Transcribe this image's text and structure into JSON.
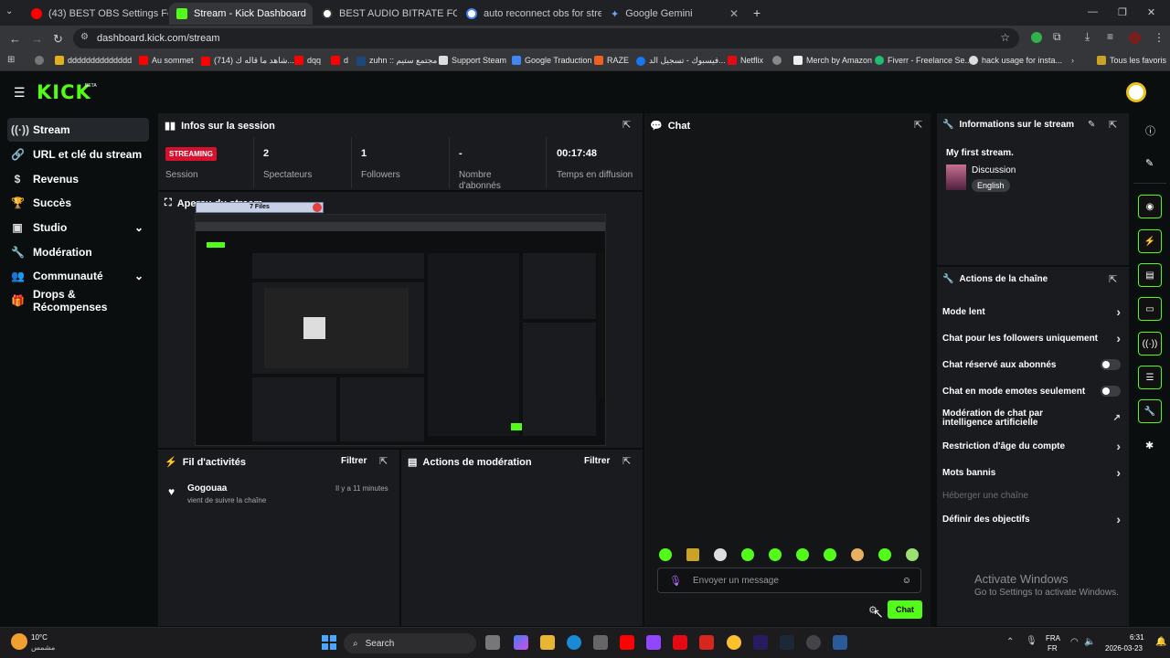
{
  "browser": {
    "tabs": [
      {
        "label": "(43) BEST OBS Settings For STR",
        "color": "#ff0000"
      },
      {
        "label": "Stream - Kick Dashboard",
        "color": "#53fc18"
      },
      {
        "label": "BEST AUDIO BITRATE FOR 505",
        "color": "#ffffff"
      },
      {
        "label": "auto reconnect obs for stream",
        "color": "#ffffff"
      },
      {
        "label": "Google Gemini",
        "color": "#6ea8ff"
      }
    ],
    "new_tab": "+",
    "url": "dashboard.kick.com/stream",
    "bookmarks": [
      "dddddddddddddd",
      "Au sommet",
      "(714) شاهد ما قاله ك...",
      "dqq",
      "d",
      "zuhn :: مجتمع ستيم",
      "Support Steam",
      "Google Traduction",
      "RAZE",
      "فيسبوك - تسجيل الد...",
      "Netflix",
      "Merch by Amazon",
      "Fiverr - Freelance Se...",
      "hack usage for insta..."
    ],
    "all_bookmarks": "Tous les favoris"
  },
  "app": {
    "logo": "KICK",
    "beta": "BETA",
    "nav": [
      {
        "label": "Stream",
        "icon": "broadcast-icon"
      },
      {
        "label": "URL et clé du stream",
        "icon": "link-icon"
      },
      {
        "label": "Revenus",
        "icon": "money-icon"
      },
      {
        "label": "Succès",
        "icon": "trophy-icon"
      },
      {
        "label": "Studio",
        "icon": "studio-icon"
      },
      {
        "label": "Modération",
        "icon": "wrench-icon"
      },
      {
        "label": "Communauté",
        "icon": "community-icon"
      },
      {
        "label": "Drops & Récompenses",
        "icon": "gift-icon"
      }
    ],
    "session": {
      "title": "Infos sur la session",
      "badge": "STREAMING",
      "badge_label": "Session",
      "stats": [
        {
          "value": "2",
          "label": "Spectateurs"
        },
        {
          "value": "1",
          "label": "Followers"
        },
        {
          "value": "-",
          "label": "Nombre d'abonnés"
        },
        {
          "value": "00:17:48",
          "label": "Temps en diffusion"
        }
      ]
    },
    "preview": {
      "title": "Aperçu du stream",
      "overlay": "7 Files"
    },
    "activity": {
      "title": "Fil d'activités",
      "filter": "Filtrer",
      "items": [
        {
          "user": "Gogouaa",
          "text": "vient de suivre la chaîne",
          "time": "Il y a 11 minutes"
        }
      ]
    },
    "moderation": {
      "title": "Actions de modération",
      "filter": "Filtrer"
    },
    "chat": {
      "title": "Chat",
      "placeholder": "Envoyer un message",
      "send": "Chat"
    },
    "stream_info": {
      "title": "Informations sur le stream",
      "stream_title": "My first stream.",
      "category": "Discussion",
      "language": "English"
    },
    "channel_actions": {
      "title": "Actions de la chaîne",
      "items": [
        {
          "label": "Mode lent",
          "control": "arrow"
        },
        {
          "label": "Chat pour les followers uniquement",
          "control": "arrow"
        },
        {
          "label": "Chat réservé aux abonnés",
          "control": "toggle"
        },
        {
          "label": "Chat en mode emotes seulement",
          "control": "toggle"
        },
        {
          "label": "Modération de chat par intelligence artificielle",
          "control": "external"
        },
        {
          "label": "Restriction d'âge du compte",
          "control": "arrow"
        },
        {
          "label": "Mots bannis",
          "control": "arrow"
        },
        {
          "label": "Héberger une chaîne",
          "control": "disabled"
        },
        {
          "label": "Définir des objectifs",
          "control": "arrow"
        }
      ]
    },
    "activate_windows": {
      "title": "Activate Windows",
      "subtitle": "Go to Settings to activate Windows."
    }
  },
  "taskbar": {
    "weather_temp": "10°C",
    "weather_desc": "مشمس",
    "search": "Search",
    "lang": "FRA",
    "lang2": "FR",
    "time": "6:31",
    "date": "2026-03-23"
  }
}
